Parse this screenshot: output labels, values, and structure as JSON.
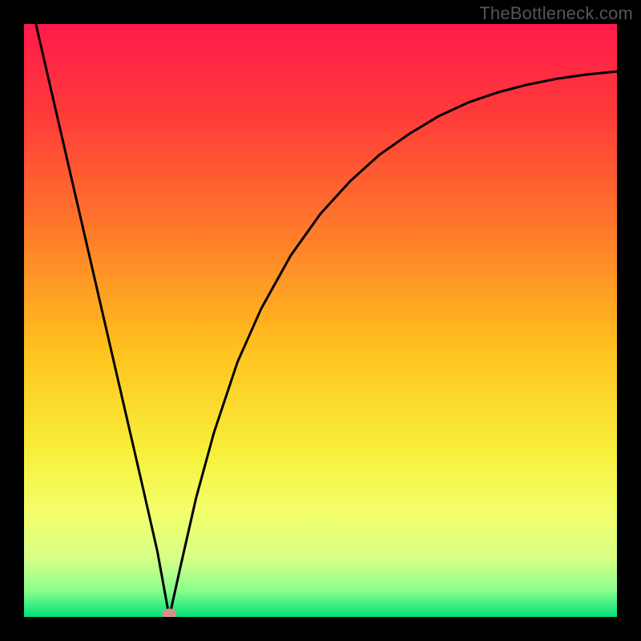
{
  "watermark": "TheBottleneck.com",
  "chart_data": {
    "type": "line",
    "title": "",
    "xlabel": "",
    "ylabel": "",
    "xlim": [
      0,
      1
    ],
    "ylim": [
      0,
      1
    ],
    "grid": false,
    "legend": false,
    "background_gradient": {
      "direction": "vertical",
      "stops": [
        {
          "offset": 0.0,
          "color": "#ff1a4b"
        },
        {
          "offset": 0.15,
          "color": "#ff3a3a"
        },
        {
          "offset": 0.35,
          "color": "#ff7a2a"
        },
        {
          "offset": 0.55,
          "color": "#ffc21e"
        },
        {
          "offset": 0.72,
          "color": "#f7ef3a"
        },
        {
          "offset": 0.82,
          "color": "#f4ff6a"
        },
        {
          "offset": 0.9,
          "color": "#d8ff86"
        },
        {
          "offset": 0.955,
          "color": "#8cff8c"
        },
        {
          "offset": 1.0,
          "color": "#00e07a"
        }
      ]
    },
    "min_marker": {
      "x": 0.245,
      "y": 0.0,
      "color": "#d89088"
    },
    "series": [
      {
        "name": "bottleneck-curve",
        "stroke": "#000000",
        "stroke_width": 3,
        "x": [
          0.02,
          0.05,
          0.08,
          0.11,
          0.14,
          0.17,
          0.2,
          0.225,
          0.245,
          0.265,
          0.29,
          0.32,
          0.36,
          0.4,
          0.45,
          0.5,
          0.55,
          0.6,
          0.65,
          0.7,
          0.75,
          0.8,
          0.85,
          0.9,
          0.95,
          1.0
        ],
        "y": [
          1.0,
          0.87,
          0.74,
          0.61,
          0.48,
          0.35,
          0.22,
          0.11,
          0.0,
          0.09,
          0.2,
          0.31,
          0.43,
          0.52,
          0.61,
          0.68,
          0.735,
          0.78,
          0.815,
          0.845,
          0.868,
          0.885,
          0.898,
          0.908,
          0.915,
          0.92
        ]
      }
    ]
  }
}
